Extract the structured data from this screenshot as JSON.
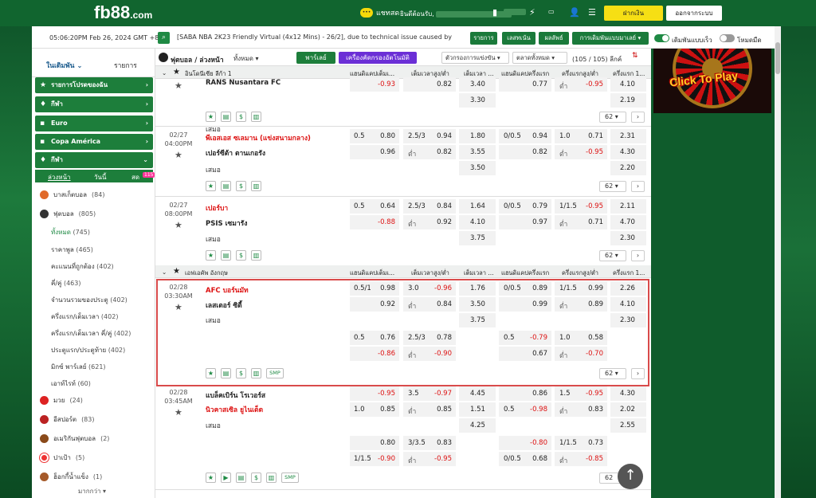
{
  "header": {
    "logo_main": "fb88",
    "logo_tld": ".com",
    "chat": "แชทสด",
    "welcome": "ยินดีต้อนรับ,",
    "deposit": "ฝากเงิน",
    "logout": "ออกจากระบบ"
  },
  "topbar": {
    "time": "05:06:20PM Feb 26, 2024 GMT +8",
    "ticker": "[SABA NBA 2K23 Friendly Virtual (4x12 Mins) - 26/2], due to technical issue caused by",
    "btn_list": "รายการ",
    "btn_result": "เลสทเน้น",
    "btn_stats": "ผลลัพธ์",
    "btn_settings": "การเดิมพันแบบมาเลย์ ▾",
    "toggle1": "เดิมพันแบบเร็ว",
    "toggle2": "โหมดมืด"
  },
  "sidebar": {
    "tab1": "ในเดิมพัน",
    "tab2": "รายการ",
    "bars": [
      "รายการโปรดของฉัน",
      "กีฬา",
      "Euro",
      "Copa América",
      "กีฬา"
    ],
    "subtabs": [
      "ล่วงหน้า",
      "วันนี้",
      "สด"
    ],
    "badge": "115",
    "sports": [
      {
        "name": "บาสเก็ตบอล",
        "count": "(84)"
      },
      {
        "name": "ฟุตบอล",
        "count": "(805)"
      }
    ],
    "soccer_sub": [
      {
        "name": "ทั้งหมด",
        "count": "(745)"
      },
      {
        "name": "ราคาพูล",
        "count": "(465)"
      },
      {
        "name": "คะแนนที่ถูกต้อง",
        "count": "(402)"
      },
      {
        "name": "คี่/คู่",
        "count": "(463)"
      },
      {
        "name": "จำนวนรวมของประตู",
        "count": "(402)"
      },
      {
        "name": "ครึ่งแรก/เต็มเวลา",
        "count": "(402)"
      },
      {
        "name": "ครึ่งแรก/เต็มเวลา คี่/คู่",
        "count": "(402)"
      },
      {
        "name": "ประตูแรก/ประตูท้าย",
        "count": "(402)"
      },
      {
        "name": "มิกซ์ พาร์เลย์",
        "count": "(621)"
      },
      {
        "name": "เอาท์ไรท์",
        "count": "(60)"
      }
    ],
    "others": [
      {
        "name": "มวย",
        "count": "(24)"
      },
      {
        "name": "อีสปอร์ต",
        "count": "(83)"
      },
      {
        "name": "อเมริกันฟุตบอล",
        "count": "(2)"
      },
      {
        "name": "ปาเป้า",
        "count": "(5)"
      },
      {
        "name": "ฮ็อกกี้น้ำแข็ง",
        "count": "(1)"
      }
    ],
    "more": "มากกว่า ▾"
  },
  "main": {
    "title": "ฟุตบอล / ล่วงหน้า",
    "filter": "ทั้งหมด ▾",
    "parlay": "พาร์เลย์",
    "market": "เครื่องคัดกรองอัตโนมัติ",
    "sel1": "ตัวกรองการแข่งขัน ▾",
    "sel2": "ตลาดทั้งหมด ▾",
    "leagues_count": "(105 / 105) ลีกค์"
  },
  "league1": {
    "name": "อินโดนีเซีย ลีก้า 1",
    "c1": "แฮนดิแคปเต็มเ...",
    "c2": "เต็มเวลาสูง/ต่ำ",
    "c3": "เต็มเวลา ...",
    "c4": "แฮนดิแคปครึ่งแรก",
    "c5": "ครึ่งแรกสูง/ต่ำ",
    "c6": "ครึ่งแรก 1..."
  },
  "league2": {
    "name": "เอฟเอคัพ อังกฤษ",
    "c1": "แฮนดิแคปเต็มเ...",
    "c2": "เต็มเวลาสูง/ต่ำ",
    "c3": "เต็มเวลา ...",
    "c4": "แฮนดิแคปครึ่งแรก",
    "c5": "ครึ่งแรกสูง/ต่ำ",
    "c6": "ครึ่งแรก 1..."
  },
  "m0": {
    "team": "RANS Nusantara FC",
    "draw": "เสมอ",
    "a2": "-0.93",
    "b2": "0.82",
    "c1": "3.40",
    "c2": "3.30",
    "d2": "0.77",
    "e2": "-0.95",
    "f1": "4.10",
    "f2": "2.19",
    "lo": "ต่ำ",
    "more": "62 ▾"
  },
  "m1": {
    "date": "02/27",
    "time": "04:00PM",
    "home": "พีเอสเอส ซเลมาน (แข่งสนามกลาง)",
    "away": "เปอร์ซีต้า ตานเกอรัง",
    "draw": "เสมอ",
    "h1": "0.5",
    "a1": "0.80",
    "a2": "0.96",
    "g1": "2.5/3",
    "b1": "0.94",
    "lo": "ต่ำ",
    "b2": "0.82",
    "c1": "1.80",
    "c2": "3.55",
    "c3": "3.50",
    "h2": "0/0.5",
    "d1": "0.94",
    "d2": "0.82",
    "g2": "1.0",
    "e1": "0.71",
    "e2": "-0.95",
    "f1": "2.31",
    "f2": "4.30",
    "f3": "2.20",
    "more": "62 ▾"
  },
  "m2": {
    "date": "02/27",
    "time": "08:00PM",
    "home": "เปอร์บา",
    "away": "PSIS เซมารัง",
    "draw": "เสมอ",
    "h1": "0.5",
    "a1": "0.64",
    "a2": "-0.88",
    "g1": "2.5/3",
    "b1": "0.84",
    "lo": "ต่ำ",
    "b2": "0.92",
    "c1": "1.64",
    "c2": "4.10",
    "c3": "3.75",
    "h2": "0/0.5",
    "d1": "0.79",
    "d2": "0.97",
    "g2": "1/1.5",
    "e1": "-0.95",
    "e2": "0.71",
    "f1": "2.11",
    "f2": "4.70",
    "f3": "2.30",
    "more": "62 ▾"
  },
  "m3": {
    "date": "02/28",
    "time": "03:30AM",
    "home": "AFC บอร์นมัท",
    "away": "เลสเตอร์ ซิตี้",
    "draw": "เสมอ",
    "h1": "0.5/1",
    "a1": "0.98",
    "a2": "0.92",
    "g1": "3.0",
    "b1": "-0.96",
    "lo": "ต่ำ",
    "b2": "0.84",
    "c1": "1.76",
    "c2": "3.50",
    "c3": "3.75",
    "h2": "0/0.5",
    "d1": "0.89",
    "d2": "0.99",
    "g2": "1/1.5",
    "e1": "0.99",
    "e2": "0.89",
    "f1": "2.26",
    "f2": "4.10",
    "f3": "2.30",
    "x_h1": "0.5",
    "x_a1": "0.76",
    "x_a2": "-0.86",
    "x_g1": "2.5/3",
    "x_b1": "0.78",
    "x_b2": "-0.90",
    "x_h2": "0.5",
    "x_d1": "-0.79",
    "x_d2": "0.67",
    "x_g2": "1.0",
    "x_e1": "0.58",
    "x_e2": "-0.70",
    "smp": "SMP",
    "more": "62 ▾"
  },
  "m4": {
    "date": "02/28",
    "time": "03:45AM",
    "home": "แบล็คเบิร์น โรเวอร์ส",
    "away": "นิวคาสเซิล ยูไนเต็ด",
    "draw": "เสมอ",
    "a1": "-0.95",
    "a2": "0.85",
    "h2l": "1.0",
    "g1": "3.5",
    "b1": "-0.97",
    "lo": "ต่ำ",
    "b2": "0.85",
    "c1": "4.45",
    "c2": "1.51",
    "c3": "4.25",
    "d1": "0.86",
    "h3": "0.5",
    "d2": "-0.98",
    "g2": "1.5",
    "e1": "-0.95",
    "e2": "0.83",
    "f1": "4.30",
    "f2": "2.02",
    "f3": "2.55",
    "x_a1": "0.80",
    "x_h1": "1/1.5",
    "x_a2": "-0.90",
    "x_g1": "3/3.5",
    "x_b1": "0.83",
    "x_b2": "-0.95",
    "x_d1": "-0.80",
    "x_h2": "0/0.5",
    "x_d2": "0.68",
    "x_g2": "1/1.5",
    "x_e1": "0.73",
    "x_e2": "-0.85",
    "smp": "SMP",
    "more": "62"
  },
  "banner": {
    "text": "Click To Play"
  },
  "colors": {
    "brand": "#11652f",
    "accent": "#f6df14",
    "negative": "#d11111"
  }
}
